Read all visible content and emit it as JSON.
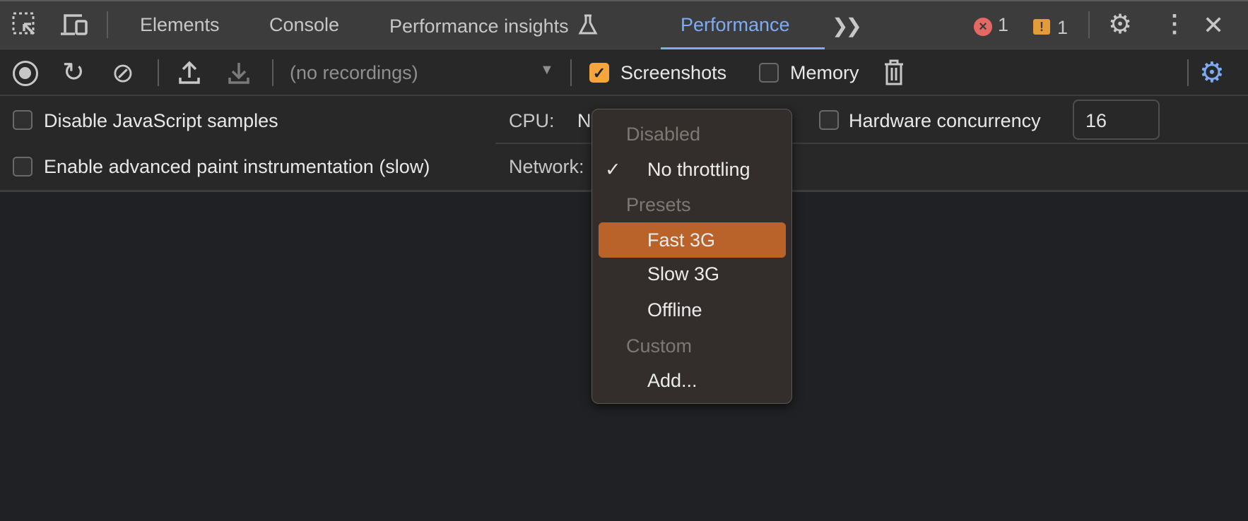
{
  "tabs": {
    "elements": "Elements",
    "console": "Console",
    "perf_insights": "Performance insights",
    "performance": "Performance",
    "error_count": "1",
    "warning_count": "1"
  },
  "toolbar": {
    "recordings": "(no recordings)",
    "screenshots": "Screenshots",
    "memory": "Memory",
    "screenshots_checked": true,
    "memory_checked": false
  },
  "settings": {
    "disable_js": "Disable JavaScript samples",
    "advanced_paint": "Enable advanced paint instrumentation (slow)",
    "cpu_label": "CPU:",
    "cpu_value": "N",
    "network_label": "Network:",
    "hw_concurrency": "Hardware concurrency",
    "hw_value": "16"
  },
  "menu": {
    "disabled": "Disabled",
    "no_throttling": "No throttling",
    "presets": "Presets",
    "fast3g": "Fast 3G",
    "slow3g": "Slow 3G",
    "offline": "Offline",
    "custom": "Custom",
    "add": "Add...",
    "check": "✓"
  },
  "colors": {
    "accent": "#7cacf8",
    "highlight": "#b9632a",
    "checkbox": "#f5a53b",
    "error": "#e46962",
    "warning": "#e49c3b"
  }
}
